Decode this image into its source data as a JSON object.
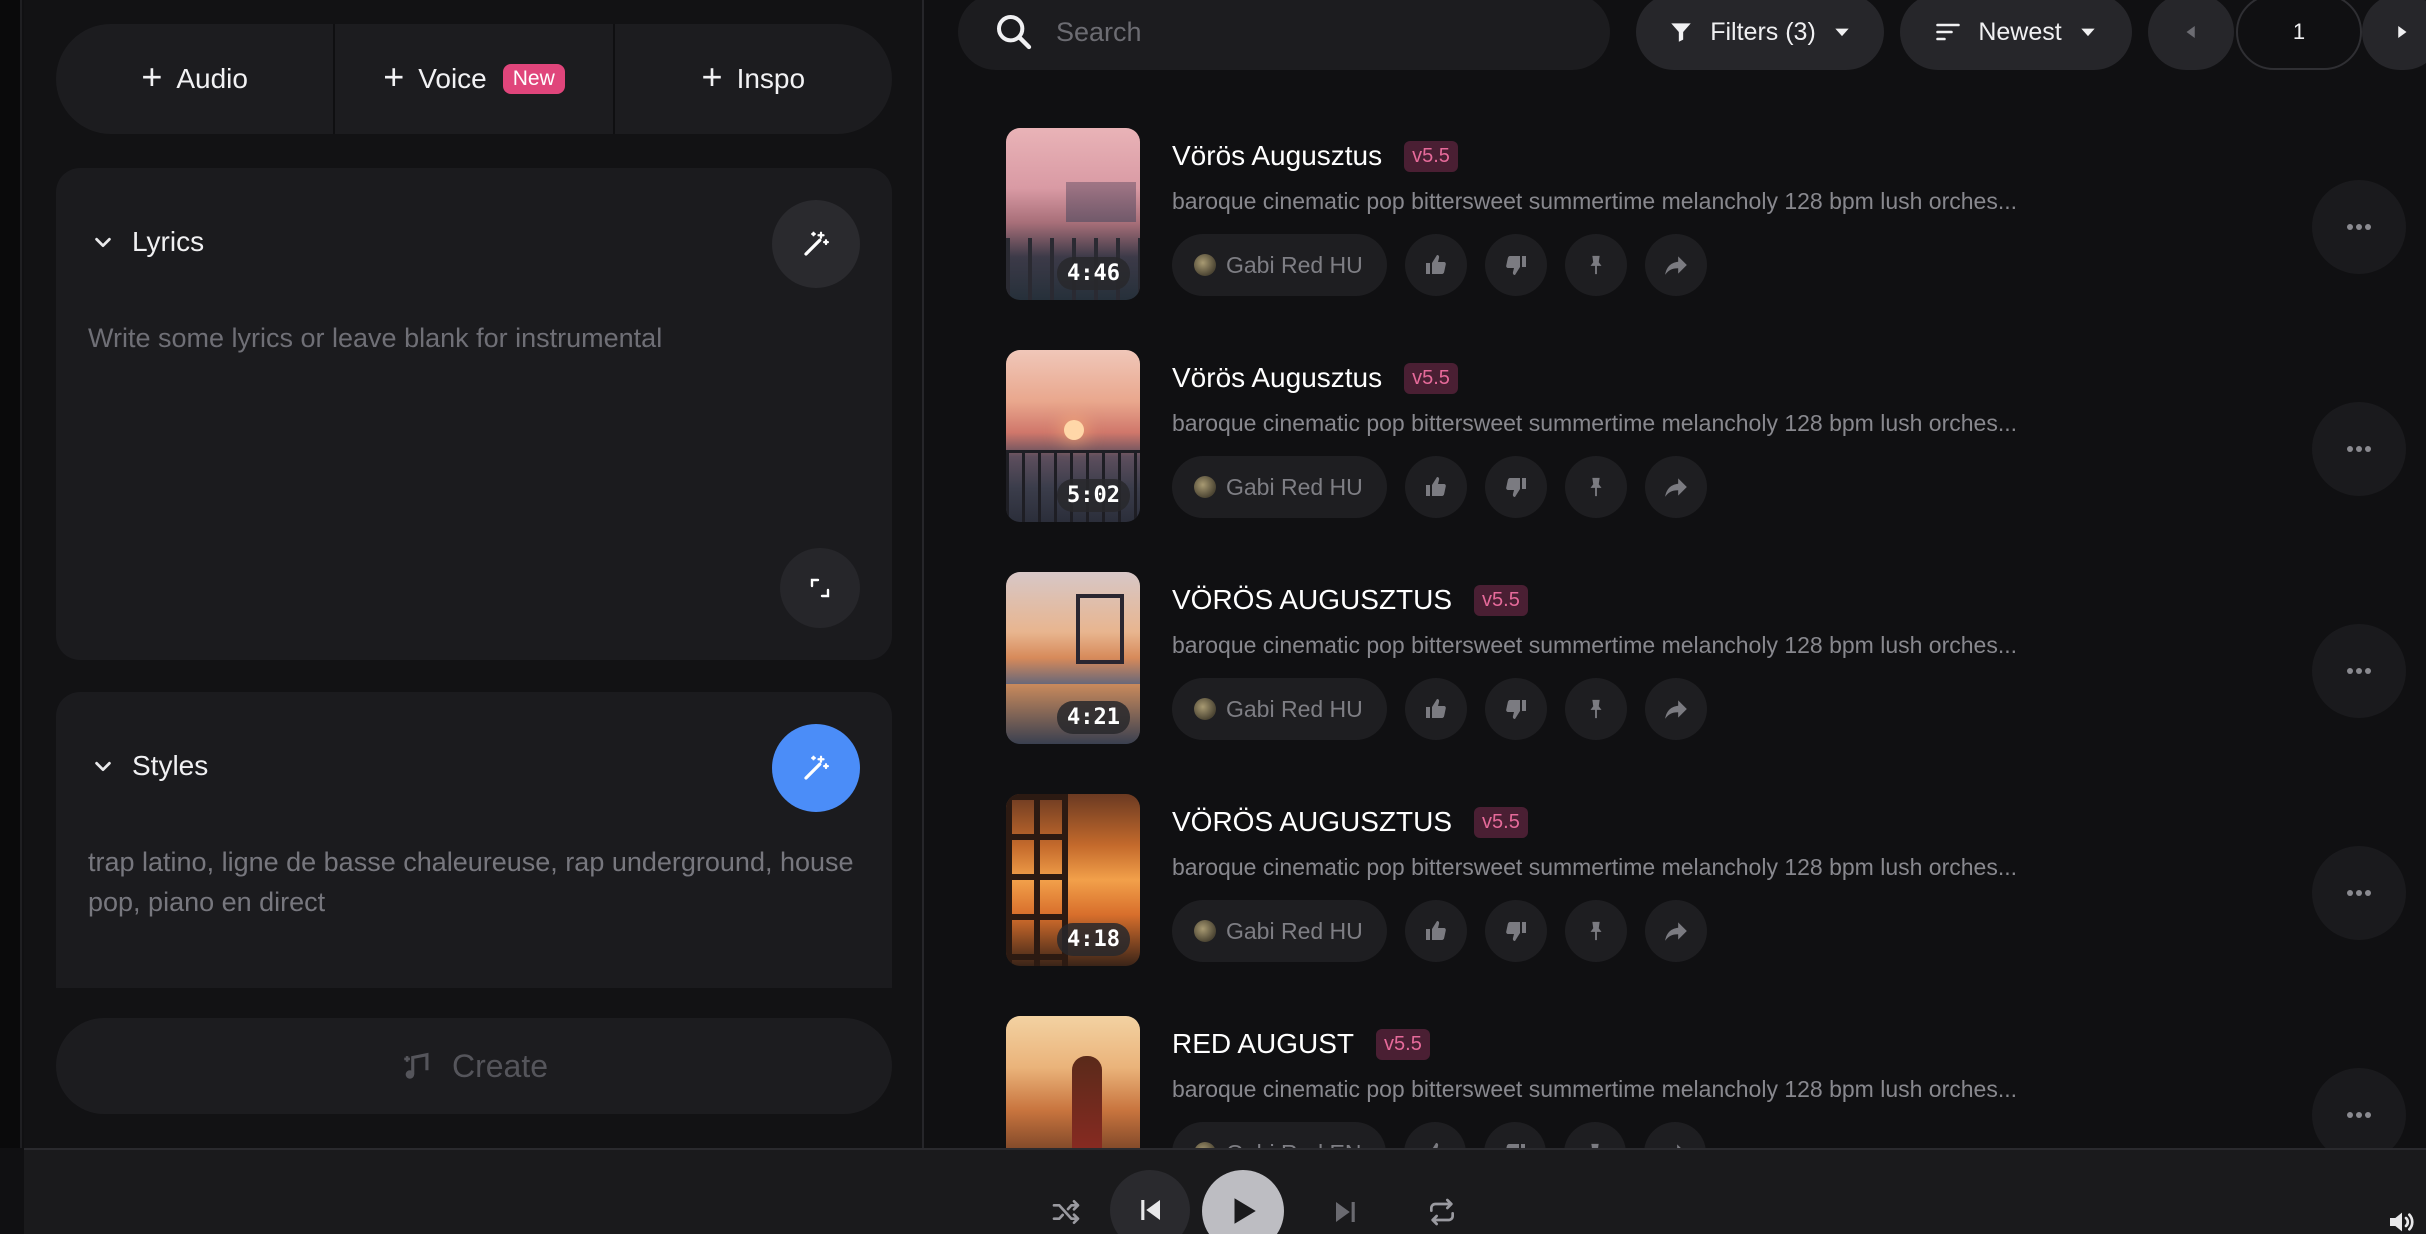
{
  "create_tabs": [
    {
      "label": "Audio"
    },
    {
      "label": "Voice",
      "badge": "New"
    },
    {
      "label": "Inspo"
    }
  ],
  "lyrics": {
    "heading": "Lyrics",
    "placeholder": "Write some lyrics or leave blank for instrumental"
  },
  "styles": {
    "heading": "Styles",
    "value": "trap latino, ligne de basse chaleureuse, rap underground, house pop, piano en direct"
  },
  "create_label": "Create",
  "search": {
    "placeholder": "Search"
  },
  "filters_label": "Filters (3)",
  "sort_label": "Newest",
  "page_number": "1",
  "songs": [
    {
      "title": "Vörös Augusztus",
      "version": "v5.5",
      "description": "baroque cinematic pop bittersweet summertime melancholy 128 bpm lush orches...",
      "artist": "Gabi Red HU",
      "duration": "4:46"
    },
    {
      "title": "Vörös Augusztus",
      "version": "v5.5",
      "description": "baroque cinematic pop bittersweet summertime melancholy 128 bpm lush orches...",
      "artist": "Gabi Red HU",
      "duration": "5:02"
    },
    {
      "title": "VÖRÖS AUGUSZTUS",
      "version": "v5.5",
      "description": "baroque cinematic pop bittersweet summertime melancholy 128 bpm lush orches...",
      "artist": "Gabi Red HU",
      "duration": "4:21"
    },
    {
      "title": "VÖRÖS AUGUSZTUS",
      "version": "v5.5",
      "description": "baroque cinematic pop bittersweet summertime melancholy 128 bpm lush orches...",
      "artist": "Gabi Red HU",
      "duration": "4:18"
    },
    {
      "title": "RED AUGUST",
      "version": "v5.5",
      "description": "baroque cinematic pop bittersweet summertime melancholy 128 bpm lush orches...",
      "artist": "Gabi Red EN",
      "duration": ""
    }
  ],
  "colors": {
    "accent_blue": "#4b8df8",
    "badge_pink": "#e0457b",
    "version_text": "#e66a9a"
  },
  "icons": [
    "plus-icon",
    "magic-wand-icon",
    "expand-icon",
    "chevron-down-icon",
    "music-note-icon",
    "search-icon",
    "filter-icon",
    "sort-icon",
    "caret-down-icon",
    "arrow-left-icon",
    "arrow-right-icon",
    "thumbs-up-icon",
    "thumbs-down-icon",
    "pin-icon",
    "share-icon",
    "more-icon",
    "shuffle-icon",
    "skip-back-icon",
    "play-icon",
    "skip-forward-icon",
    "repeat-icon",
    "volume-icon"
  ]
}
